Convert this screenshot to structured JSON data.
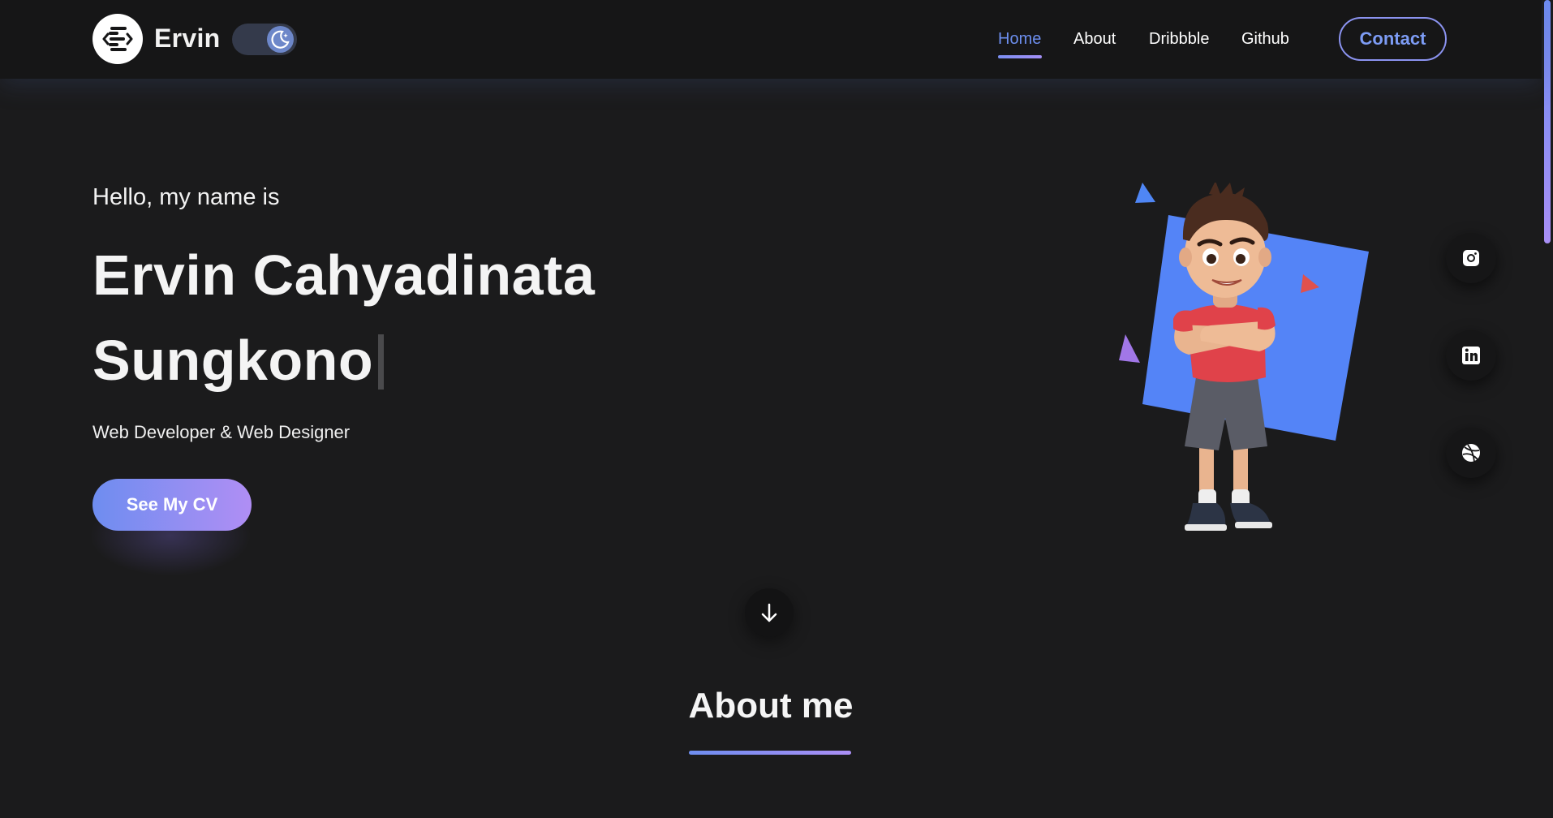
{
  "brand": {
    "name": "Ervin",
    "logo_icon": "code-e-logo-icon",
    "theme_icon": "moon-icon"
  },
  "nav": {
    "links": [
      {
        "label": "Home",
        "active": true
      },
      {
        "label": "About"
      },
      {
        "label": "Dribbble"
      },
      {
        "label": "Github"
      }
    ],
    "contact_label": "Contact"
  },
  "hero": {
    "greeting": "Hello, my name is",
    "name_line1": "Ervin Cahyadinata",
    "name_line2": "Sungkono",
    "role": "Web Developer & Web Designer",
    "cv_button": "See My CV"
  },
  "social": [
    {
      "name": "instagram",
      "icon": "instagram-icon"
    },
    {
      "name": "linkedin",
      "icon": "linkedin-icon"
    },
    {
      "name": "dribbble",
      "icon": "dribbble-icon"
    }
  ],
  "scroll": {
    "icon": "arrow-down-icon"
  },
  "about": {
    "heading": "About me"
  },
  "colors": {
    "background": "#1b1b1c",
    "navbar": "#161617",
    "accent_blue": "#6e8df0",
    "accent_purple": "#b08ef4",
    "card_blue": "#5484f7"
  }
}
